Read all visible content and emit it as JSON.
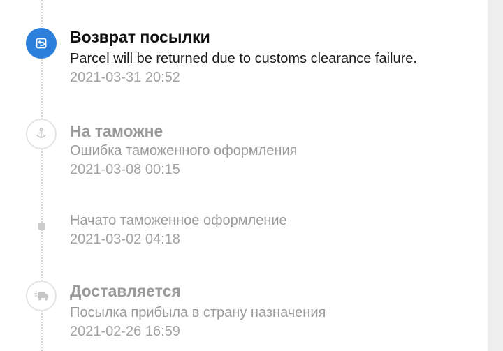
{
  "colors": {
    "accent": "#2d7fdc",
    "inactive_text": "#9a9a9a",
    "timestamp_text": "#a3a3a3"
  },
  "events": [
    {
      "title": "Возврат посылки",
      "description": "Parcel will be returned due to customs clearance failure.",
      "time": "2021-03-31 20:52",
      "icon": "return-icon",
      "active": true
    },
    {
      "title": "На таможне",
      "description": "Ошибка таможенного оформления",
      "time": "2021-03-08 00:15",
      "icon": "anchor-icon",
      "active": false
    },
    {
      "title": "",
      "description": "Начато таможенное оформление",
      "time": "2021-03-02 04:18",
      "icon": "dot-marker",
      "active": false
    },
    {
      "title": "Доставляется",
      "description": "Посылка прибыла в страну назначения",
      "time": "2021-02-26 16:59",
      "icon": "truck-icon",
      "active": false
    }
  ]
}
